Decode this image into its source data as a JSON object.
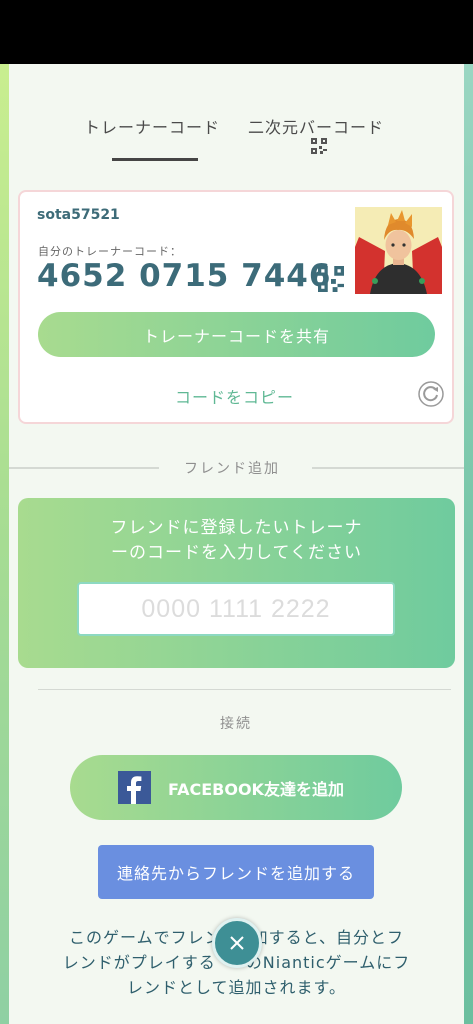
{
  "tabs": {
    "trainer_code": "トレーナーコード",
    "qr_code": "二次元バーコード"
  },
  "profile": {
    "username": "sota57521",
    "code_label": "自分のトレーナーコード：",
    "trainer_code": "4652 0715 7446"
  },
  "actions": {
    "share_label": "トレーナーコードを共有",
    "copy_label": "コードをコピー"
  },
  "add_friend": {
    "section_title": "フレンド追加",
    "prompt_line1": "フレンドに登録したいトレーナ",
    "prompt_line2": "ーのコードを入力してください",
    "input_placeholder": "0000 1111 2222"
  },
  "connect": {
    "section_title": "接続",
    "facebook_label": "FACEBOOK友達を追加",
    "contacts_label": "連絡先からフレンドを追加する",
    "footer_line1": "このゲームでフレン",
    "footer_line1b": "加すると、自分とフ",
    "footer_line2": "レンドがプレイする",
    "footer_line2b": "のNianticゲームにフ",
    "footer_line3": "レンドとして追加されます。"
  },
  "icons": {
    "qr": "qr-code-icon",
    "refresh": "refresh-icon",
    "facebook": "facebook-icon",
    "close": "close-icon"
  },
  "colors": {
    "accent_gradient_start": "#a8db8f",
    "accent_gradient_end": "#6fcb9e",
    "code_text": "#3c6b79",
    "contacts_button": "#6a8fe0",
    "close_button": "#3e8f95"
  }
}
